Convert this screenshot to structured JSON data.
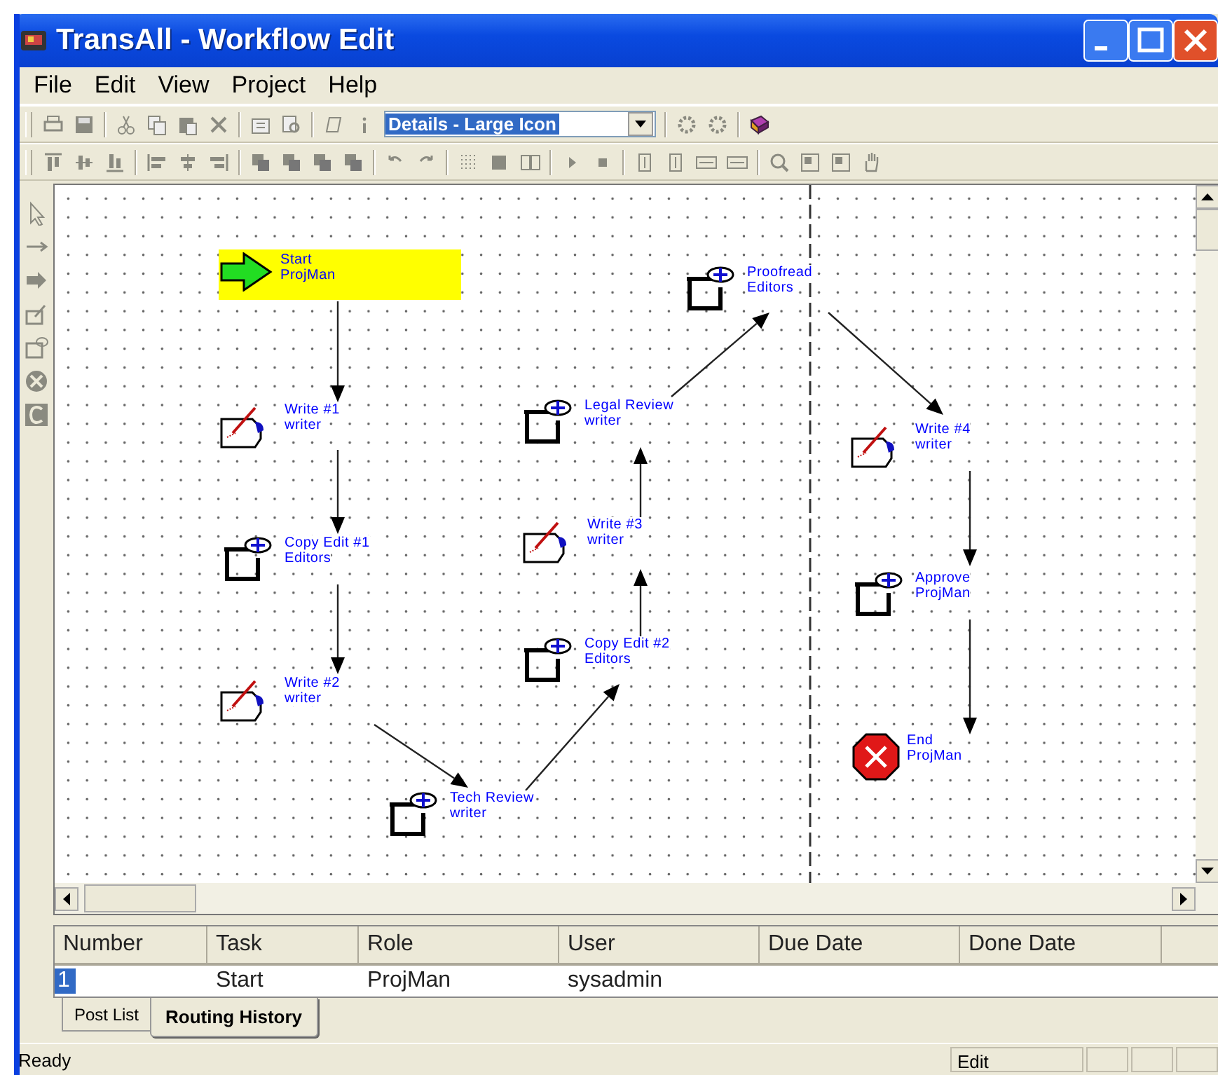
{
  "window": {
    "title": "TransAll - Workflow Edit"
  },
  "menu": [
    "File",
    "Edit",
    "View",
    "Project",
    "Help"
  ],
  "toolbar": {
    "view_select": {
      "value": "Details - Large Icon"
    }
  },
  "workflow": {
    "nodes": [
      {
        "kind": "start",
        "task": "Start",
        "role": "ProjMan",
        "selected": true
      },
      {
        "kind": "write",
        "task": "Write #1",
        "role": "writer",
        "selected": false
      },
      {
        "kind": "review",
        "task": "Copy Edit #1",
        "role": "Editors",
        "selected": false
      },
      {
        "kind": "write",
        "task": "Write #2",
        "role": "writer",
        "selected": false
      },
      {
        "kind": "review",
        "task": "Proofread",
        "role": "Editors",
        "selected": false
      },
      {
        "kind": "review",
        "task": "Legal Review",
        "role": "writer",
        "selected": false
      },
      {
        "kind": "write",
        "task": "Write #3",
        "role": "writer",
        "selected": false
      },
      {
        "kind": "review",
        "task": "Copy Edit #2",
        "role": "Editors",
        "selected": false
      },
      {
        "kind": "review",
        "task": "Tech Review",
        "role": "writer",
        "selected": false
      },
      {
        "kind": "write",
        "task": "Write #4",
        "role": "writer",
        "selected": false
      },
      {
        "kind": "review",
        "task": "Approve",
        "role": "ProjMan",
        "selected": false
      },
      {
        "kind": "end",
        "task": "End",
        "role": "ProjMan",
        "selected": false
      }
    ]
  },
  "history": {
    "columns": [
      "Number",
      "Task",
      "Role",
      "User",
      "Due Date",
      "Done Date"
    ],
    "rows": [
      {
        "cells": [
          "1",
          "Start",
          "ProjMan",
          "sysadmin"
        ],
        "selected": true
      }
    ]
  },
  "tabs": [
    {
      "label": "Post List",
      "selected": false
    },
    {
      "label": "Routing History",
      "selected": true
    }
  ],
  "status_bar": {
    "message": "Ready",
    "mode": "Edit"
  }
}
